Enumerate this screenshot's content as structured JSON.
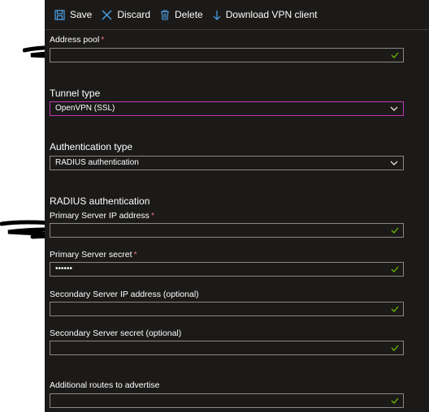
{
  "toolbar": {
    "save_label": "Save",
    "discard_label": "Discard",
    "delete_label": "Delete",
    "download_label": "Download VPN client"
  },
  "form": {
    "address_pool_label": "Address pool",
    "tunnel_type_label": "Tunnel type",
    "tunnel_type_value": "OpenVPN (SSL)",
    "auth_type_label": "Authentication type",
    "auth_type_value": "RADIUS authentication",
    "radius_section_label": "RADIUS authentication",
    "primary_ip_label": "Primary Server IP address",
    "primary_secret_label": "Primary Server secret",
    "primary_secret_value": "••••••",
    "secondary_ip_label": "Secondary Server IP address (optional)",
    "secondary_secret_label": "Secondary Server secret (optional)",
    "routes_label": "Additional routes to advertise",
    "required_marker": "*"
  },
  "colors": {
    "panel_bg": "#1b1a19",
    "accent_blue": "#4aa0e6",
    "valid_green": "#6bb700",
    "required_red": "#f1707b",
    "focus_border": "#c239b3"
  }
}
